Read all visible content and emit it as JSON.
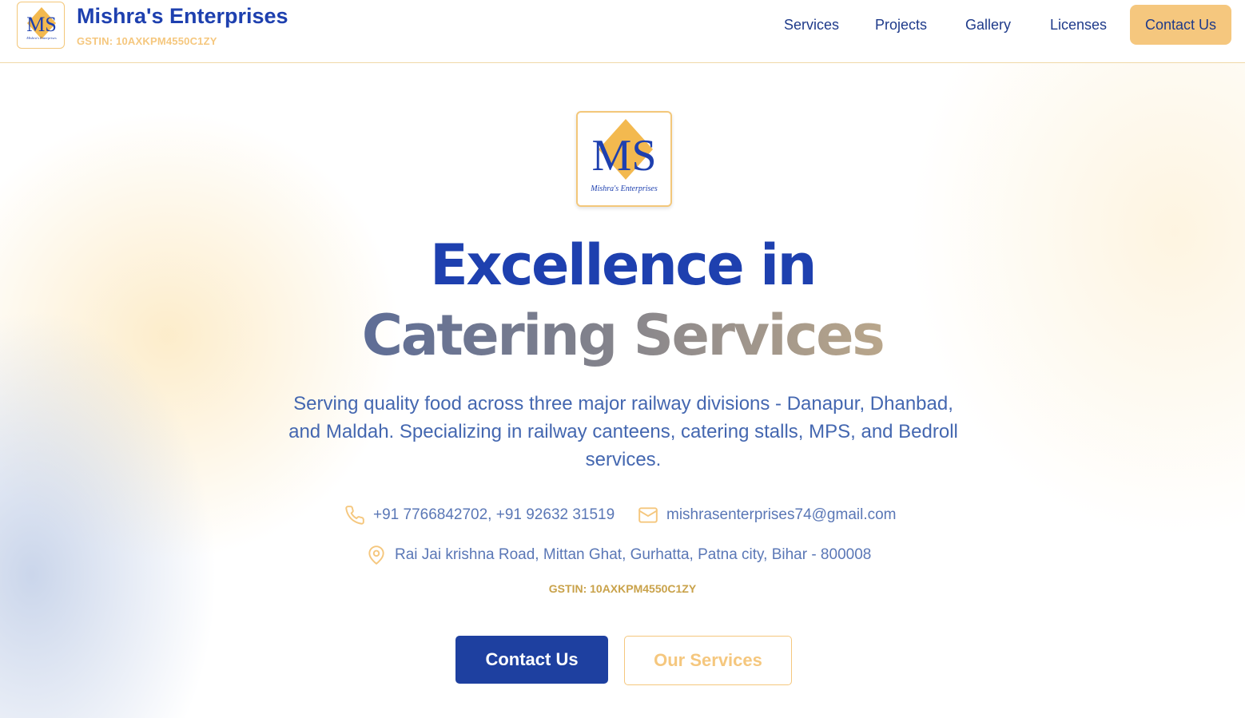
{
  "colors": {
    "brand_blue": "#1e40af",
    "gold": "#f5c77e",
    "muted_blue": "#4467b0"
  },
  "header": {
    "logo": {
      "letters": "MS",
      "caption": "Mishra's Enterprises"
    },
    "brand_name": "Mishra's Enterprises",
    "gstin": "GSTIN: 10AXKPM4550C1ZY",
    "nav": {
      "services": "Services",
      "projects": "Projects",
      "gallery": "Gallery",
      "licenses": "Licenses",
      "contact": "Contact Us"
    }
  },
  "hero": {
    "logo": {
      "letters": "MS",
      "caption": "Mishra's Enterprises"
    },
    "title_line1": "Excellence in",
    "title_line2": "Catering Services",
    "description": "Serving quality food across three major railway divisions - Danapur, Dhanbad, and Maldah. Specializing in railway canteens, catering stalls, MPS, and Bedroll services.",
    "phone_icon": "phone-icon",
    "phone": "+91 7766842702, +91 92632 31519",
    "email_icon": "mail-icon",
    "email": "mishrasenterprises74@gmail.com",
    "address_icon": "map-pin-icon",
    "address": "Rai Jai krishna Road, Mittan Ghat, Gurhatta, Patna city, Bihar - 800008",
    "gstin": "GSTIN: 10AXKPM4550C1ZY",
    "buttons": {
      "primary": "Contact Us",
      "secondary": "Our Services"
    }
  }
}
